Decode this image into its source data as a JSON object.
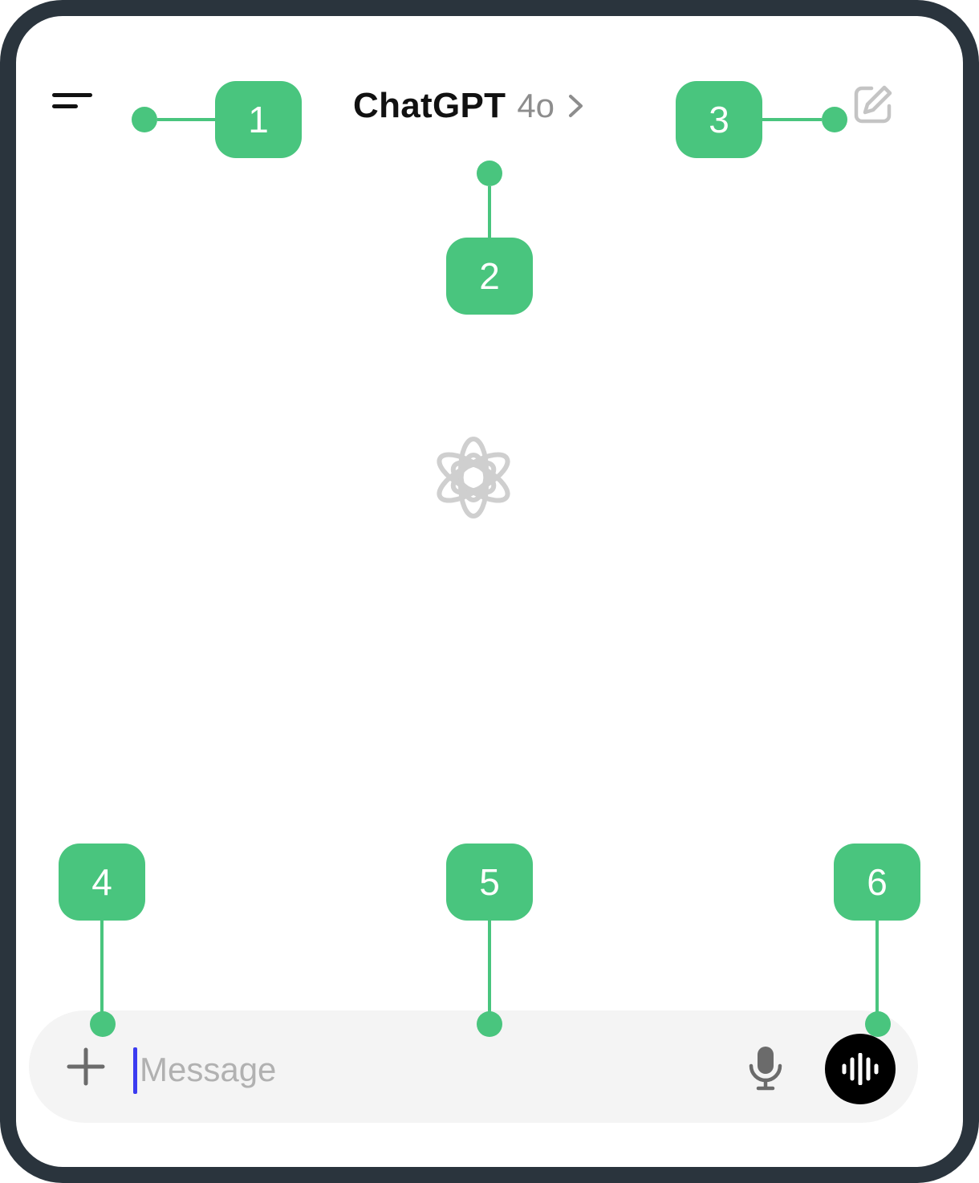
{
  "header": {
    "title": "ChatGPT",
    "model": "4o",
    "menu_icon": "menu-icon",
    "chevron_icon": "chevron-right-icon",
    "compose_icon": "new-chat-icon"
  },
  "main": {
    "logo_icon": "openai-logo-icon"
  },
  "composer": {
    "placeholder": "Message",
    "attach_icon": "plus-icon",
    "mic_icon": "microphone-icon",
    "voice_icon": "voice-mode-icon"
  },
  "annotations": [
    "1",
    "2",
    "3",
    "4",
    "5",
    "6"
  ],
  "colors": {
    "annotation_green": "#49c57e",
    "frame": "#2a343d",
    "caret": "#3b3bf0",
    "input_bg": "#f4f4f4",
    "voice_button_bg": "#000000"
  }
}
